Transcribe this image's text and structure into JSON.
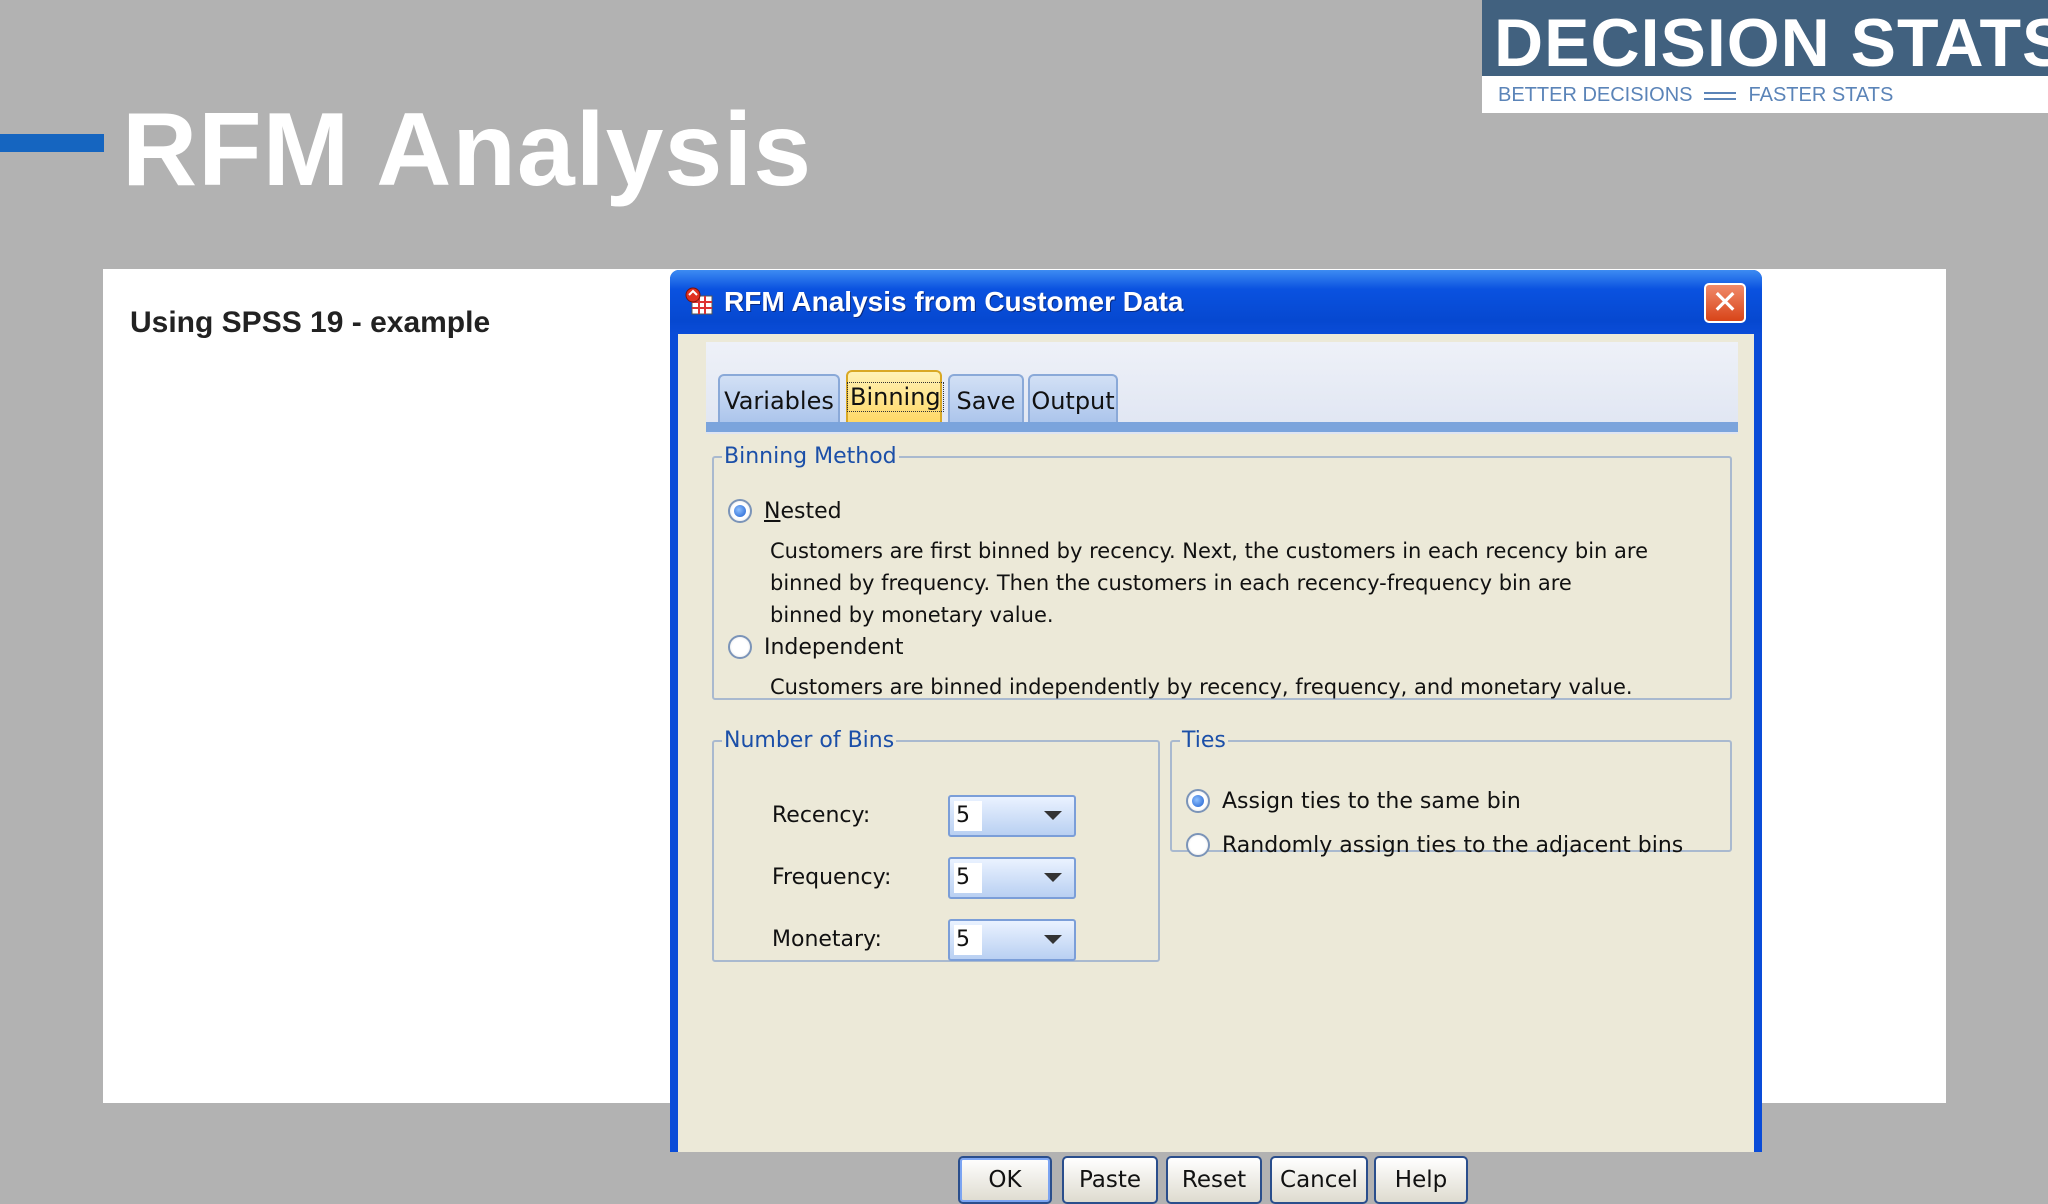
{
  "slide": {
    "title": "RFM Analysis",
    "subtitle": "Using SPSS 19 - example",
    "accent_color": "#1565c0"
  },
  "logo": {
    "main": "DECISION STATS",
    "tag_left": "BETTER DECISIONS",
    "tag_right": "FASTER STATS"
  },
  "dialog": {
    "title": "RFM Analysis from Customer Data",
    "close_icon": "close-icon",
    "tabs": [
      {
        "label": "Variables",
        "active": false
      },
      {
        "label": "Binning",
        "active": true
      },
      {
        "label": "Save",
        "active": false
      },
      {
        "label": "Output",
        "active": false
      }
    ],
    "binning_method": {
      "legend": "Binning Method",
      "nested_label": "Nested",
      "nested_desc": "Customers are first binned by recency. Next, the customers in each recency bin are binned by frequency. Then the customers in each recency-frequency bin are binned by monetary value.",
      "independent_label": "Independent",
      "independent_desc": "Customers are binned independently by recency, frequency, and monetary value.",
      "selected": "Nested"
    },
    "number_of_bins": {
      "legend": "Number of Bins",
      "recency_label": "Recency:",
      "recency_value": "5",
      "frequency_label": "Frequency:",
      "frequency_value": "5",
      "monetary_label": "Monetary:",
      "monetary_value": "5"
    },
    "ties": {
      "legend": "Ties",
      "same_bin_label": "Assign ties to the same bin",
      "random_label": "Randomly assign ties to the adjacent bins",
      "selected": "Assign ties to the same bin"
    },
    "buttons": {
      "ok": "OK",
      "paste": "Paste",
      "reset": "Reset",
      "cancel": "Cancel",
      "help": "Help"
    }
  }
}
